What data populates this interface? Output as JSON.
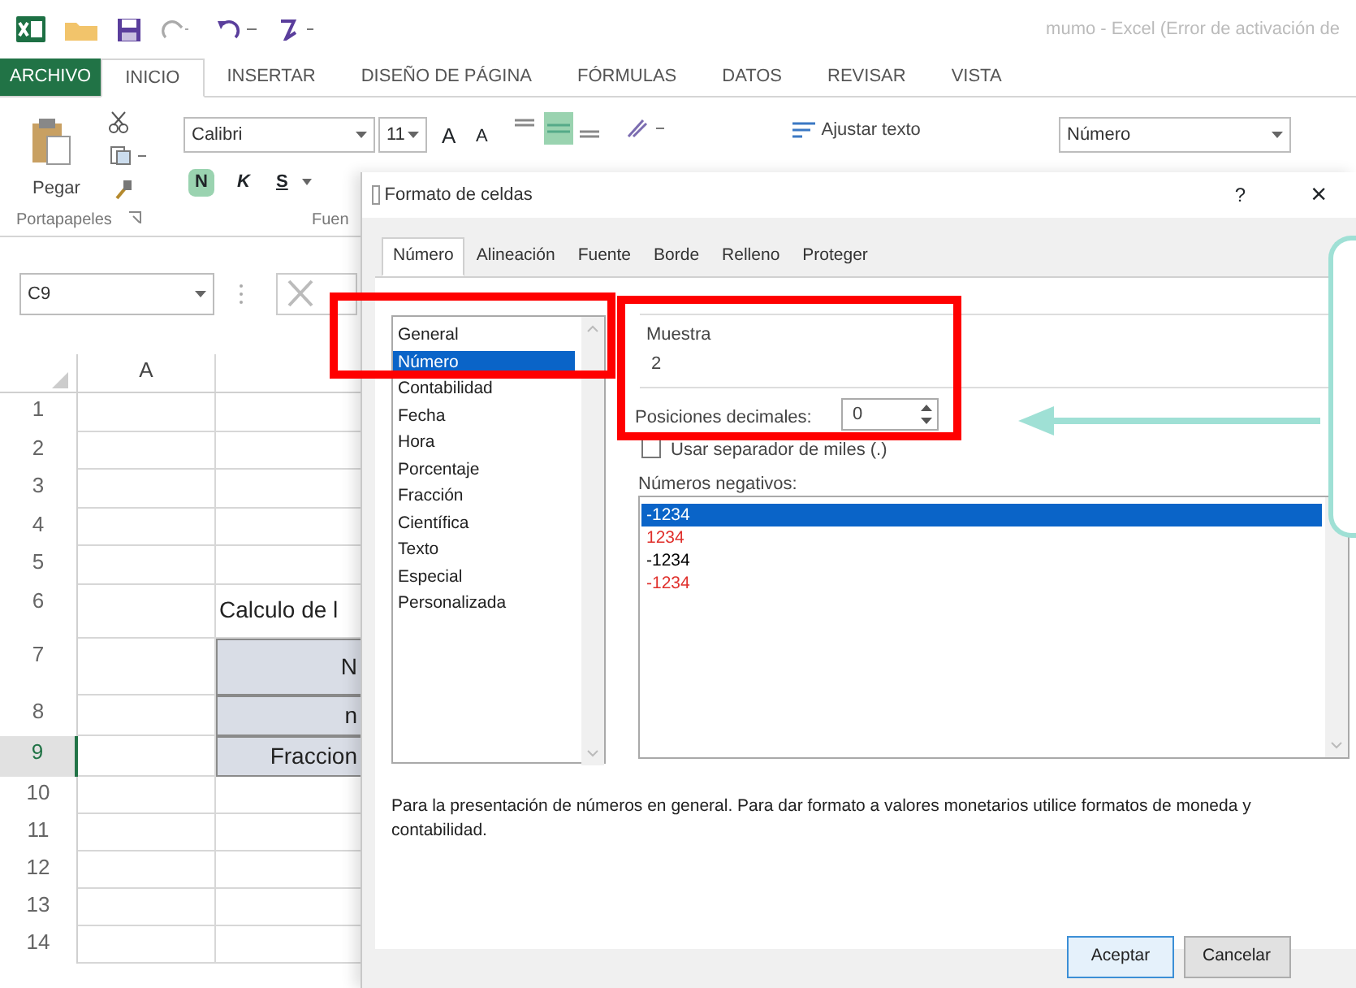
{
  "app": {
    "title": "mumo - Excel (Error de activación de"
  },
  "ribbon_tabs": [
    {
      "label": "ARCHIVO",
      "kind": "file",
      "selected": false
    },
    {
      "label": "INICIO",
      "kind": "tab",
      "selected": true
    },
    {
      "label": "INSERTAR",
      "kind": "tab",
      "selected": false
    },
    {
      "label": "DISEÑO DE PÁGINA",
      "kind": "tab",
      "selected": false
    },
    {
      "label": "FÓRMULAS",
      "kind": "tab",
      "selected": false
    },
    {
      "label": "DATOS",
      "kind": "tab",
      "selected": false
    },
    {
      "label": "REVISAR",
      "kind": "tab",
      "selected": false
    },
    {
      "label": "VISTA",
      "kind": "tab",
      "selected": false
    }
  ],
  "ribbon": {
    "paste_label": "Pegar",
    "font_name": "Calibri",
    "font_size": "11",
    "grow_font": "A",
    "shrink_font": "A",
    "wrap_text": "Ajustar texto",
    "number_format": "Número",
    "bold": "N",
    "italic": "K",
    "underline": "S",
    "group_labels": [
      "Portapapeles",
      "Fuen"
    ]
  },
  "name_box": "C9",
  "sheet": {
    "columns": [
      "A"
    ],
    "rows": [
      {
        "header": "1",
        "selected": false
      },
      {
        "header": "2",
        "selected": false
      },
      {
        "header": "3",
        "selected": false
      },
      {
        "header": "4",
        "selected": false
      },
      {
        "header": "5",
        "selected": false
      },
      {
        "header": "6",
        "selected": false,
        "cell_b": "Calculo de l",
        "kind": "title"
      },
      {
        "header": "7",
        "selected": false,
        "cell_b": "N",
        "kind": "shaded"
      },
      {
        "header": "8",
        "selected": false,
        "cell_b": "n",
        "kind": "shaded"
      },
      {
        "header": "9",
        "selected": true,
        "cell_b": "Fraccion",
        "kind": "shaded"
      },
      {
        "header": "10",
        "selected": false
      },
      {
        "header": "11",
        "selected": false
      },
      {
        "header": "12",
        "selected": false
      },
      {
        "header": "13",
        "selected": false
      },
      {
        "header": "14",
        "selected": false
      }
    ]
  },
  "dialog": {
    "title": "Formato de celdas",
    "help": "?",
    "close": "×",
    "tabs": [
      {
        "label": "Número",
        "selected": true
      },
      {
        "label": "Alineación",
        "selected": false
      },
      {
        "label": "Fuente",
        "selected": false
      },
      {
        "label": "Borde",
        "selected": false
      },
      {
        "label": "Relleno",
        "selected": false
      },
      {
        "label": "Proteger",
        "selected": false
      }
    ],
    "categories": [
      {
        "label": "General",
        "selected": false
      },
      {
        "label": "Número",
        "selected": true
      },
      {
        "label": "Contabilidad",
        "selected": false
      },
      {
        "label": "Fecha",
        "selected": false
      },
      {
        "label": "Hora",
        "selected": false
      },
      {
        "label": "Porcentaje",
        "selected": false
      },
      {
        "label": "Fracción",
        "selected": false
      },
      {
        "label": "Científica",
        "selected": false
      },
      {
        "label": "Texto",
        "selected": false
      },
      {
        "label": "Especial",
        "selected": false
      },
      {
        "label": "Personalizada",
        "selected": false
      }
    ],
    "sample_label": "Muestra",
    "sample_value": "2",
    "decimals_label": "Posiciones decimales:",
    "decimals_value": "0",
    "thousands_label": "Usar separador de miles (.)",
    "thousands_checked": false,
    "negatives_label": "Números negativos:",
    "negatives": [
      {
        "text": "-1234",
        "selected": true
      },
      {
        "text": "1234",
        "color": "#e0302c",
        "selected": false
      },
      {
        "text": "-1234",
        "color": "#000000",
        "selected": false
      },
      {
        "text": "-1234",
        "color": "#e0302c",
        "selected": false
      }
    ],
    "description": "Para la presentación de números en general. Para dar formato a valores monetarios utilice formatos de moneda y contabilidad.",
    "buttons": [
      {
        "label": "Aceptar",
        "kind": "default"
      },
      {
        "label": "Cancelar",
        "kind": "normal"
      }
    ]
  }
}
